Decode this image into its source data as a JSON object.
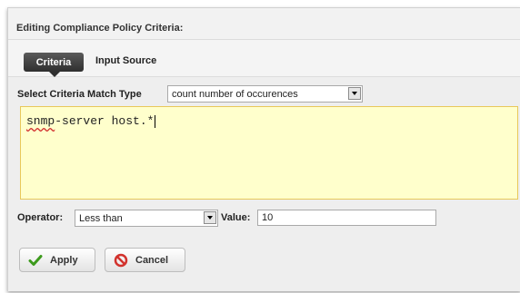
{
  "dialog": {
    "title": "Editing Compliance Policy Criteria:"
  },
  "tabs": [
    {
      "label": "Criteria",
      "active": true
    },
    {
      "label": "Input Source",
      "active": false
    }
  ],
  "criteria": {
    "match_type_label": "Select Criteria Match Type",
    "match_type_value": "count number of occurences",
    "expression_word1": "snmp",
    "expression_rest": "-server host.*",
    "operator_label": "Operator:",
    "operator_value": "Less than",
    "value_label": "Value:",
    "value": "10"
  },
  "buttons": {
    "apply_label": "Apply",
    "cancel_label": "Cancel"
  },
  "colors": {
    "textarea_bg": "#ffffcc",
    "textarea_border": "#e8c85a",
    "apply_icon": "#3c9a1c",
    "cancel_icon": "#d2322d",
    "active_tab": "#3a3a3a"
  },
  "icons": {
    "apply": "checkmark-icon",
    "cancel": "no-entry-icon"
  }
}
